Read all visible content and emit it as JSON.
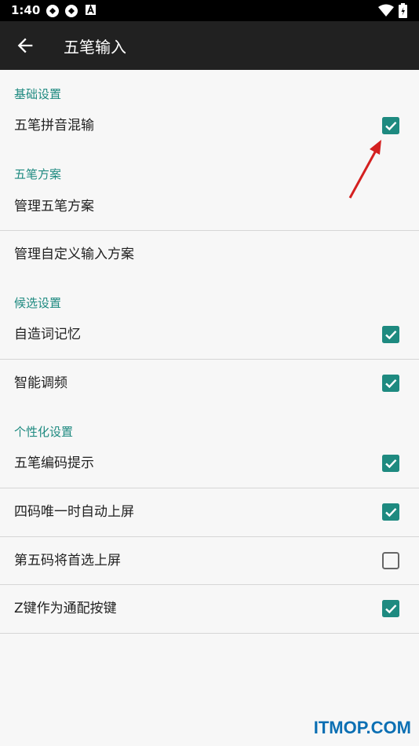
{
  "status_bar": {
    "time": "1:40",
    "icons": [
      "app-icon",
      "app-icon",
      "a-icon",
      "wifi-icon",
      "battery-icon"
    ]
  },
  "app_bar": {
    "title": "五笔输入",
    "back_icon": "arrow-back-icon"
  },
  "sections": {
    "basic": "基础设置",
    "scheme": "五笔方案",
    "candidate": "候选设置",
    "personal": "个性化设置"
  },
  "items": {
    "wubi_pinyin_mix": {
      "label": "五笔拼音混输",
      "checked": true
    },
    "manage_wubi_scheme": {
      "label": "管理五笔方案"
    },
    "manage_custom_scheme": {
      "label": "管理自定义输入方案"
    },
    "self_word_memory": {
      "label": "自造词记忆",
      "checked": true
    },
    "smart_frequency": {
      "label": "智能调频",
      "checked": true
    },
    "wubi_code_hint": {
      "label": "五笔编码提示",
      "checked": true
    },
    "four_code_unique": {
      "label": "四码唯一时自动上屏",
      "checked": true
    },
    "fifth_code_first": {
      "label": "第五码将首选上屏",
      "checked": false
    },
    "z_key_wildcard": {
      "label": "Z键作为通配按键",
      "checked": true
    }
  },
  "watermark": "ITMOP.COM",
  "colors": {
    "accent": "#1e8a80",
    "appbar": "#212121",
    "arrow": "#d42020"
  }
}
